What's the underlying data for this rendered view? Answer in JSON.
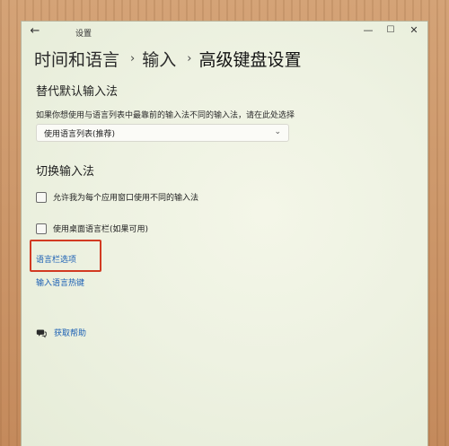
{
  "window": {
    "title": "设置",
    "controls": {
      "minimize": "—",
      "maximize": "☐",
      "close": "✕"
    }
  },
  "breadcrumb": {
    "items": [
      "时间和语言",
      "输入",
      "高级键盘设置"
    ],
    "separator": "›"
  },
  "override_section": {
    "title": "替代默认输入法",
    "description": "如果你想使用与语言列表中最靠前的输入法不同的输入法，请在此处选择",
    "dropdown_value": "使用语言列表(推荐)"
  },
  "switch_section": {
    "title": "切换输入法",
    "checkbox_per_app": "允许我为每个应用窗口使用不同的输入法",
    "checkbox_desktop_bar": "使用桌面语言栏(如果可用)",
    "language_bar_options_link": "语言栏选项",
    "input_hotkeys_link": "输入语言热键"
  },
  "help": {
    "label": "获取帮助",
    "icon": "help-chat-icon"
  },
  "colors": {
    "link": "#1a5fb4",
    "highlight_border": "#d23a22"
  }
}
